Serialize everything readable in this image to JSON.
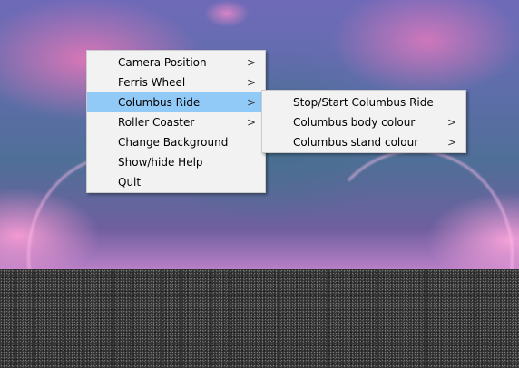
{
  "main_menu": {
    "items": [
      {
        "label": "Camera Position",
        "has_submenu": true,
        "highlighted": false
      },
      {
        "label": "Ferris Wheel",
        "has_submenu": true,
        "highlighted": false
      },
      {
        "label": "Columbus Ride",
        "has_submenu": true,
        "highlighted": true
      },
      {
        "label": "Roller Coaster",
        "has_submenu": true,
        "highlighted": false
      },
      {
        "label": "Change Background",
        "has_submenu": false,
        "highlighted": false
      },
      {
        "label": "Show/hide Help",
        "has_submenu": false,
        "highlighted": false
      },
      {
        "label": "Quit",
        "has_submenu": false,
        "highlighted": false
      }
    ]
  },
  "submenu": {
    "parent": "Columbus Ride",
    "items": [
      {
        "label": "Stop/Start Columbus Ride",
        "has_submenu": false
      },
      {
        "label": "Columbus body colour",
        "has_submenu": true
      },
      {
        "label": "Columbus stand colour",
        "has_submenu": true
      }
    ]
  },
  "icons": {
    "submenu_arrow": "chevron-right-icon"
  },
  "colors": {
    "menu_background": "#f2f2f2",
    "highlight": "#91c9f7"
  }
}
